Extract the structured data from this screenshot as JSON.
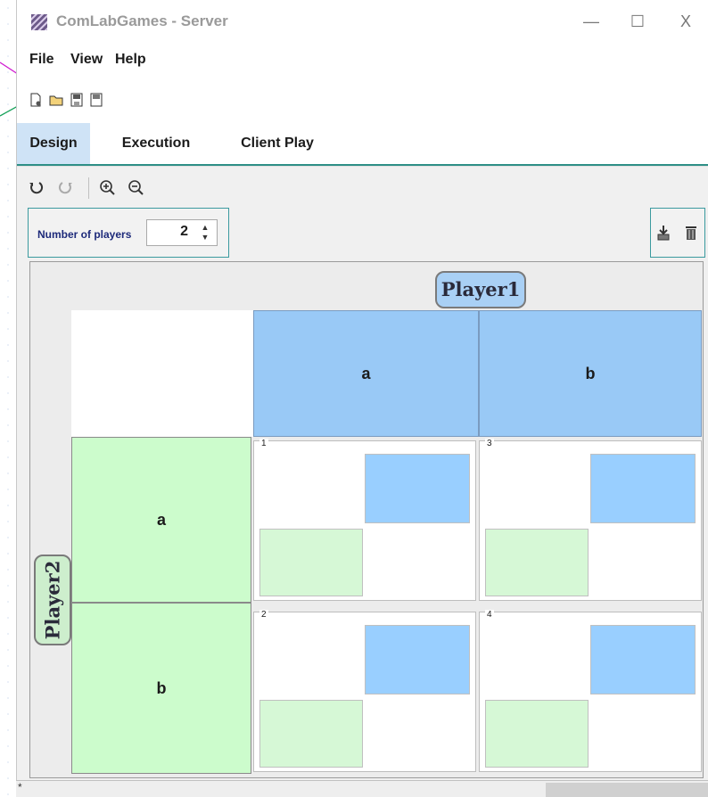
{
  "window": {
    "title": "ComLabGames - Server",
    "minimize": "—",
    "maximize": "☐",
    "close": "X"
  },
  "menu": {
    "items": [
      "File",
      "View",
      "Help"
    ]
  },
  "toolbar": {
    "icons": [
      "new-file-icon",
      "open-folder-icon",
      "save-as-icon",
      "save-icon"
    ]
  },
  "tabs": {
    "items": [
      "Design",
      "Execution",
      "Client Play"
    ],
    "active": "Design"
  },
  "design_toolbar": {
    "icons": [
      "undo-icon",
      "redo-icon",
      "zoom-in-icon",
      "zoom-out-icon"
    ]
  },
  "players": {
    "label": "Number of players",
    "value": "2",
    "spin_up": "▲",
    "spin_down": "▼"
  },
  "right_tools": {
    "icons": [
      "import-icon",
      "trash-icon"
    ]
  },
  "game": {
    "player1": "Player1",
    "player2": "Player2",
    "col_strategies": [
      "a",
      "b"
    ],
    "row_strategies": [
      "a",
      "b"
    ],
    "cells": [
      {
        "id": "1"
      },
      {
        "id": "3"
      },
      {
        "id": "2"
      },
      {
        "id": "4"
      }
    ]
  },
  "status": {
    "text": "*"
  },
  "colors": {
    "player1": "#99c9f6",
    "player2": "#ccfccc",
    "accent": "#2e8f86",
    "tab_active": "#cfe3f6"
  }
}
